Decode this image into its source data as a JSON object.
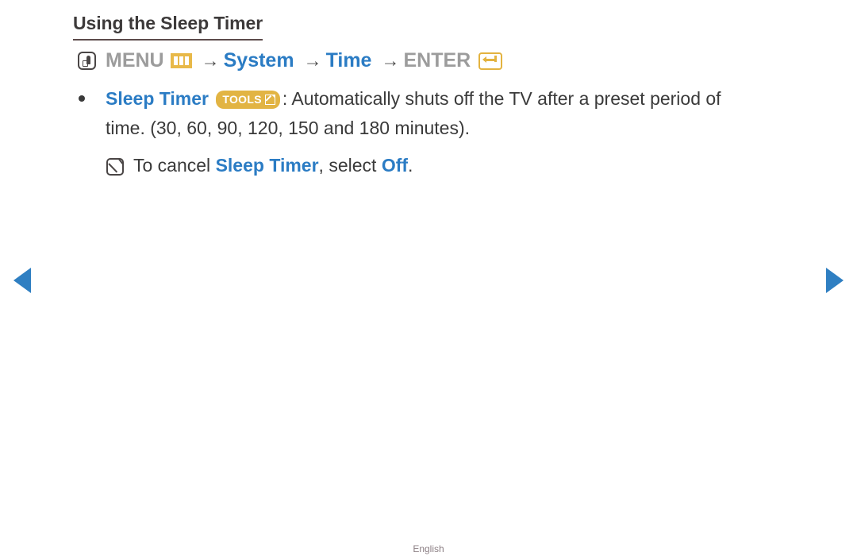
{
  "page": {
    "title": "Using the Sleep Timer",
    "language_footer": "English",
    "accent_blue": "#2b7cc4",
    "accent_gold": "#e2b443",
    "text_gray": "#9c9c9c",
    "body_text": "#3a3a3a"
  },
  "menu_path": {
    "touch_icon": "touch-press-icon",
    "menu_label": "MENU",
    "menu_icon": "menu-bars-icon",
    "arrow1": "→",
    "system_label": "System",
    "arrow2": "→",
    "time_label": "Time",
    "arrow3": "→",
    "enter_label": "ENTER",
    "enter_icon": "enter-key-icon"
  },
  "bullet": {
    "dot": "bullet-dot",
    "term": "Sleep Timer",
    "tools_badge": {
      "label": "TOOLS",
      "icon": "tools-arrow-icon"
    },
    "description_line1": ": Automatically shuts off the TV after a preset period of",
    "description_line2": "time. (30, 60, 90, 120, 150 and 180 minutes)."
  },
  "note": {
    "icon": "note-pencil-icon",
    "prefix": "To cancel ",
    "term": "Sleep Timer",
    "middle": ", select ",
    "option": "Off",
    "suffix": "."
  },
  "navigation": {
    "prev_label": "previous-page",
    "next_label": "next-page"
  }
}
